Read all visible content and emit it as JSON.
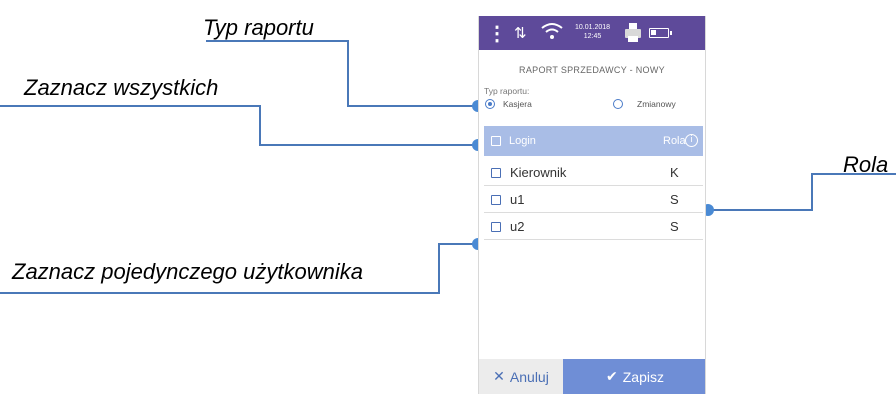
{
  "callouts": {
    "typ_raportu": "Typ raportu",
    "zaznacz_wszystkich": "Zaznacz wszystkich",
    "zaznacz_pojedynczego": "Zaznacz pojedynczego użytkownika",
    "rola": "Rola"
  },
  "statusbar": {
    "menu_icon": "⋮",
    "signal_icon": "⇅",
    "date": "10.01.2018",
    "time": "12:45",
    "battery_level": 0.35,
    "bg_color": "#5e4a9a"
  },
  "screen": {
    "title": "RAPORT SPRZEDAWCY - NOWY",
    "report_type_label": "Typ raportu:",
    "options": [
      {
        "label": "Kasjera",
        "selected": true
      },
      {
        "label": "Zmianowy",
        "selected": false
      }
    ]
  },
  "table": {
    "header": {
      "login": "Login",
      "rola": "Rola",
      "info_icon": "i"
    },
    "rows": [
      {
        "login": "Kierownik",
        "rola": "K"
      },
      {
        "login": "u1",
        "rola": "S"
      },
      {
        "login": "u2",
        "rola": "S"
      }
    ]
  },
  "buttons": {
    "cancel_icon": "✕",
    "cancel": "Anuluj",
    "save_icon": "✔",
    "save": "Zapisz"
  },
  "colors": {
    "accent": "#4a7bc8",
    "header_row": "#a9bde6",
    "save_button": "#6f8ed6",
    "callout_line": "#4a78b8"
  }
}
